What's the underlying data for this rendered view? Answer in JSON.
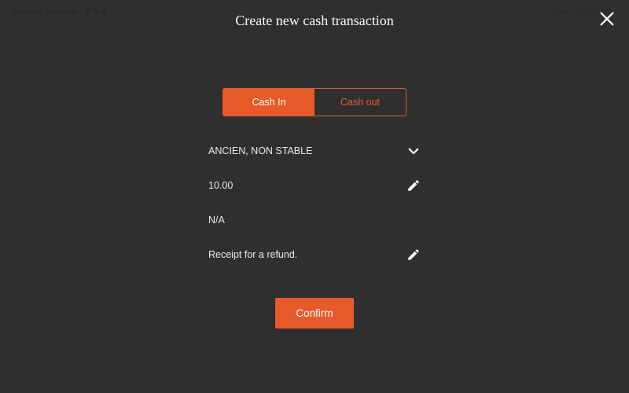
{
  "background": {
    "balance_label": "Current balance",
    "balance_amount": "€ 0.0",
    "new_transaction_button": "New Transaction"
  },
  "modal": {
    "title": "Create new cash transaction",
    "tabs": {
      "cash_in": "Cash In",
      "cash_out": "Cash out"
    },
    "rows": {
      "reason": "ANCIEN, NON STABLE",
      "amount": "10.00",
      "user": "N/A",
      "note": "Receipt for a refund."
    },
    "confirm_label": "Confirm"
  }
}
